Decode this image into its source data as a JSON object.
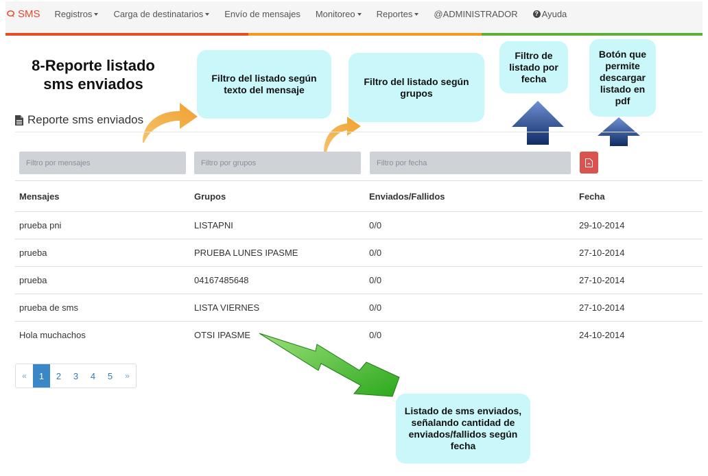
{
  "navbar": {
    "brand": "SMS",
    "items": [
      {
        "label": "Registros",
        "dropdown": true
      },
      {
        "label": "Carga de destinatarios",
        "dropdown": true
      },
      {
        "label": "Envío de mensajes",
        "dropdown": false
      },
      {
        "label": "Monitoreo",
        "dropdown": true
      },
      {
        "label": "Reportes",
        "dropdown": true
      },
      {
        "label": "@ADMINISTRADOR",
        "dropdown": false
      }
    ],
    "help_label": "Ayuda",
    "accent_colors": [
      "#e84c22",
      "#f39a1e",
      "#5fae3a"
    ]
  },
  "annotations": {
    "title_line1": "8-Reporte listado",
    "title_line2": "sms enviados",
    "callout_text_filter": "Filtro del listado según texto del mensaje",
    "callout_group_filter": "Filtro del listado según grupos",
    "callout_date_filter": "Filtro de listado por fecha",
    "callout_pdf": "Botón que permite descargar listado en pdf",
    "callout_list": "Listado de sms enviados, señalando cantidad de enviados/fallidos según fecha"
  },
  "page": {
    "header": "Reporte sms enviados"
  },
  "filters": {
    "mensajes_placeholder": "Filtro por mensajes",
    "grupos_placeholder": "Filtro por grupos",
    "fecha_placeholder": "Filtro por fecha",
    "pdf_icon": "file-pdf-icon",
    "pdf_button_color": "#d9534f"
  },
  "table": {
    "headers": [
      "Mensajes",
      "Grupos",
      "Enviados/Fallidos",
      "Fecha"
    ],
    "rows": [
      [
        "prueba pni",
        "LISTAPNI",
        "0/0",
        "29-10-2014"
      ],
      [
        "prueba",
        "PRUEBA LUNES IPASME",
        "0/0",
        "27-10-2014"
      ],
      [
        "prueba",
        "04167485648",
        "0/0",
        "27-10-2014"
      ],
      [
        "prueba de sms",
        "LISTA VIERNES",
        "0/0",
        "27-10-2014"
      ],
      [
        "Hola muchachos",
        "OTSI IPASME",
        "0/0",
        "24-10-2014"
      ]
    ]
  },
  "pagination": {
    "prev": "«",
    "pages": [
      "1",
      "2",
      "3",
      "4",
      "5"
    ],
    "active_page": "1",
    "next": "»"
  }
}
